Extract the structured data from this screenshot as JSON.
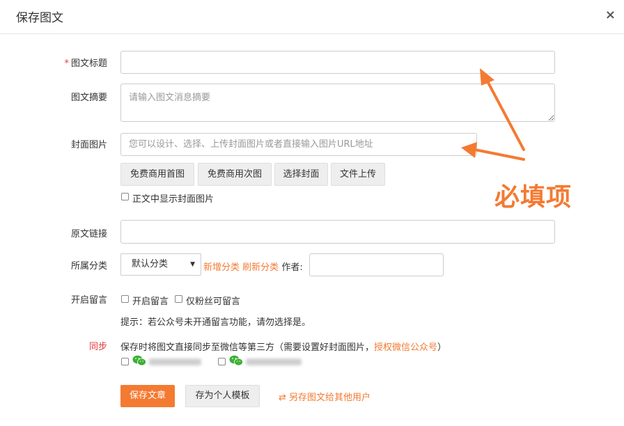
{
  "dialog": {
    "title": "保存图文",
    "close_symbol": "×"
  },
  "form": {
    "title_field": {
      "required_mark": "*",
      "label": "图文标题",
      "value": "",
      "placeholder": ""
    },
    "summary_field": {
      "label": "图文摘要",
      "value": "",
      "placeholder": "请输入图文消息摘要"
    },
    "cover_field": {
      "label": "封面图片",
      "value": "",
      "placeholder": "您可以设计、选择、上传封面图片或者直接输入图片URL地址",
      "buttons": [
        "免费商用首图",
        "免费商用次图",
        "选择封面",
        "文件上传"
      ],
      "show_in_body_label": "正文中显示封面图片",
      "show_in_body_checked": false
    },
    "source_link_field": {
      "label": "原文链接",
      "value": ""
    },
    "category_field": {
      "label": "所属分类",
      "selected": "默认分类",
      "add_link": "新增分类",
      "refresh_link": "刷新分类",
      "author_label": "作者:",
      "author_value": ""
    },
    "comment_field": {
      "label": "开启留言",
      "enable_label": "开启留言",
      "enable_checked": false,
      "fans_only_label": "仅粉丝可留言",
      "fans_only_checked": false,
      "hint": "提示：若公众号未开通留言功能，请勿选择是。"
    },
    "sync_field": {
      "label": "同步",
      "description": "保存时将图文直接同步至微信等第三方（需要设置好封面图片，",
      "auth_link": "授权微信公众号",
      "description_end": "）",
      "accounts": [
        {
          "icon": "wechat-icon",
          "checked": false
        },
        {
          "icon": "wechat-icon",
          "checked": false
        }
      ]
    }
  },
  "actions": {
    "save_label": "保存文章",
    "template_label": "存为个人模板",
    "save_as_other_icon": "⇄",
    "save_as_other_label": "另存图文给其他用户"
  },
  "annotation": {
    "text": "必填项",
    "color": "#f47a32"
  },
  "colors": {
    "accent": "#f47a32",
    "required": "#e4393c",
    "wechat": "#3cb034"
  }
}
